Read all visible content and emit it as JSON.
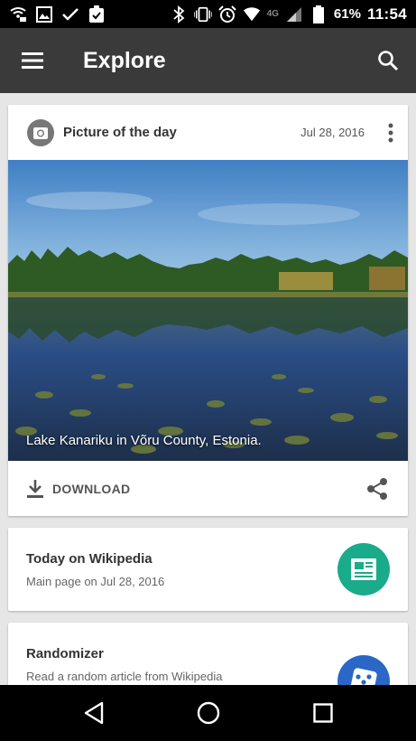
{
  "status_bar": {
    "battery_percent": "61%",
    "time": "11:54",
    "network": "4G",
    "icons": [
      "wifi-call-icon",
      "gallery-icon",
      "check-icon",
      "clipboard-check-icon",
      "bluetooth-icon",
      "vibrate-icon",
      "alarm-icon",
      "wifi-icon",
      "signal-icon",
      "battery-icon"
    ]
  },
  "app_bar": {
    "title": "Explore",
    "menu_icon": "hamburger-icon",
    "search_icon": "search-icon"
  },
  "potd": {
    "title": "Picture of the day",
    "date": "Jul 28, 2016",
    "caption": "Lake Kanariku in Võru County, Estonia.",
    "download_label": "DOWNLOAD"
  },
  "today": {
    "title": "Today on Wikipedia",
    "subtitle": "Main page on Jul 28, 2016",
    "icon_color": "#1aab8a"
  },
  "randomizer": {
    "title": "Randomizer",
    "subtitle": "Read a random article from Wikipedia",
    "icon_color": "#2a67c6"
  },
  "colors": {
    "app_bar": "#3a3a3a",
    "background": "#e6e6e6"
  }
}
